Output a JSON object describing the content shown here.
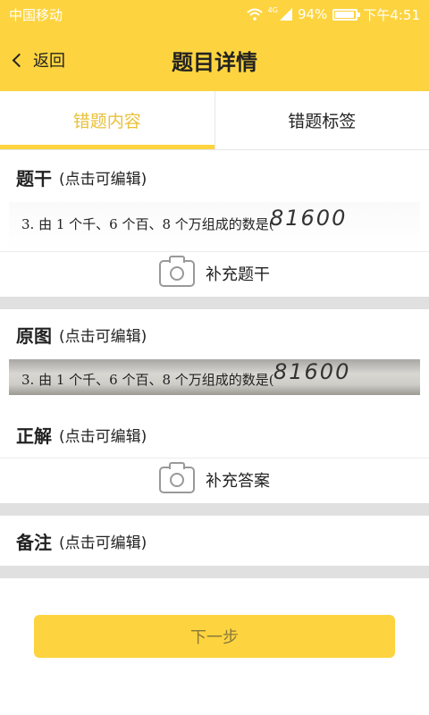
{
  "status_bar": {
    "carrier": "中国移动",
    "network": "4G",
    "battery_percent": "94%",
    "battery_level": 0.94,
    "time": "下午4:51"
  },
  "header": {
    "back_label": "返回",
    "title": "题目详情"
  },
  "tabs": [
    {
      "label": "错题内容",
      "active": true
    },
    {
      "label": "错题标签",
      "active": false
    }
  ],
  "sections": {
    "stem": {
      "title": "题干",
      "hint": "(点击可编辑)",
      "photo_text": "3. 由 1 个千、6 个百、8 个万组成的数是(",
      "handwritten": "81600",
      "add_label": "补充题干"
    },
    "original": {
      "title": "原图",
      "hint": "(点击可编辑)",
      "photo_text": "3. 由 1 个千、6 个百、8 个万组成的数是(",
      "handwritten": "81600"
    },
    "answer": {
      "title": "正解",
      "hint": "(点击可编辑)",
      "add_label": "补充答案"
    },
    "notes": {
      "title": "备注",
      "hint": "(点击可编辑)"
    }
  },
  "footer": {
    "next_label": "下一步"
  },
  "colors": {
    "accent": "#fdd43f",
    "active_tab_text": "#e8c13a"
  }
}
